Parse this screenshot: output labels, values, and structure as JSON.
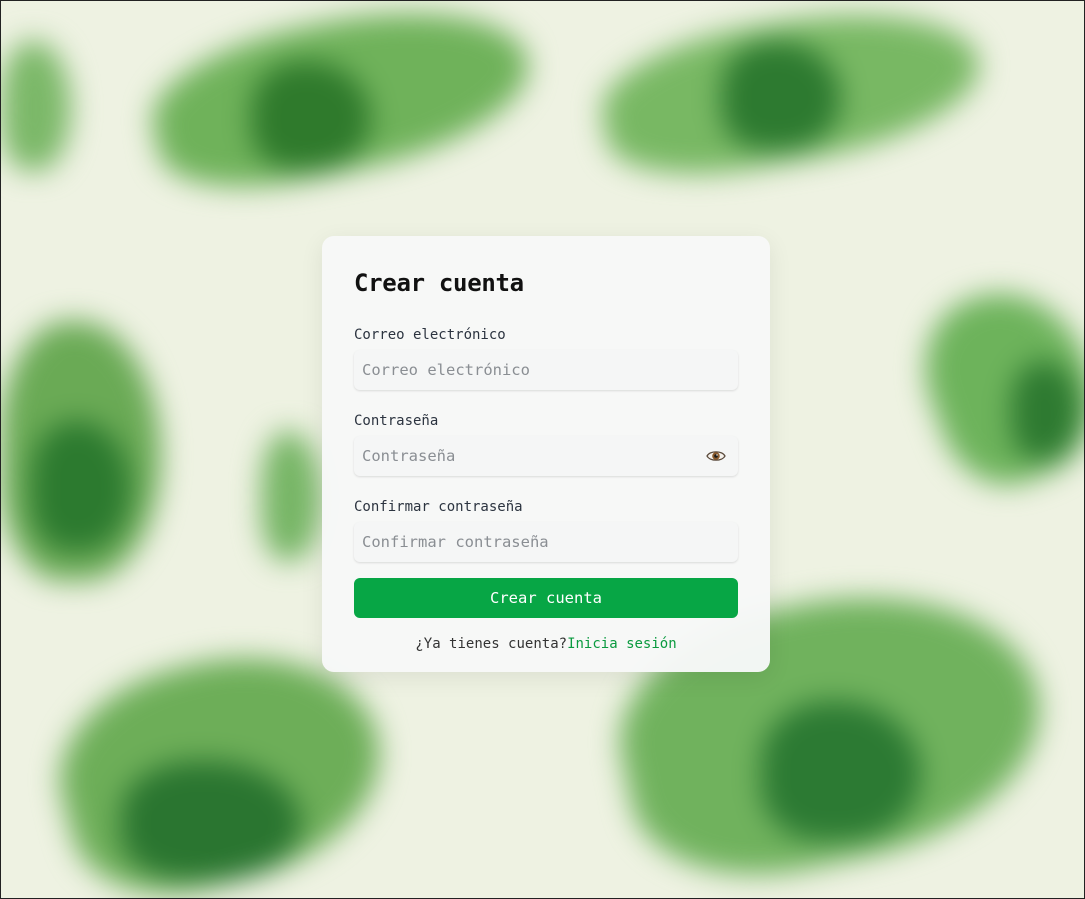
{
  "form": {
    "title": "Crear cuenta",
    "email": {
      "label": "Correo electrónico",
      "placeholder": "Correo electrónico",
      "value": ""
    },
    "password": {
      "label": "Contraseña",
      "placeholder": "Contraseña",
      "value": "",
      "toggle_icon": "eye-icon"
    },
    "confirm_password": {
      "label": "Confirmar contraseña",
      "placeholder": "Confirmar contraseña",
      "value": ""
    },
    "submit_label": "Crear cuenta",
    "footer_text": "¿Ya tienes cuenta?",
    "login_link": "Inicia sesión"
  },
  "colors": {
    "accent": "#07a645",
    "link": "#0a9a3f",
    "background": "#eef2e2"
  }
}
